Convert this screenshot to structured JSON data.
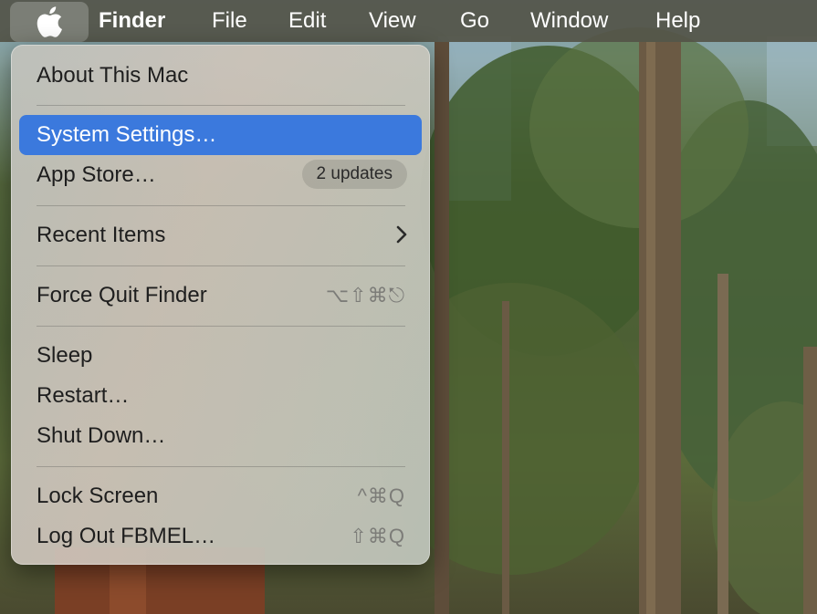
{
  "menubar": {
    "app_name": "Finder",
    "items": [
      "File",
      "Edit",
      "View",
      "Go",
      "Window",
      "Help"
    ]
  },
  "apple_menu": {
    "about": "About This Mac",
    "system_settings": "System Settings…",
    "app_store": "App Store…",
    "app_store_badge": "2 updates",
    "recent_items": "Recent Items",
    "force_quit": "Force Quit Finder",
    "force_quit_shortcut": "⌥⇧⌘⎋",
    "sleep": "Sleep",
    "restart": "Restart…",
    "shut_down": "Shut Down…",
    "lock_screen": "Lock Screen",
    "lock_screen_shortcut": "^⌘Q",
    "log_out": "Log Out FBMEL…",
    "log_out_shortcut": "⇧⌘Q"
  },
  "colors": {
    "highlight": "#3b79dd",
    "menubar": "#545448"
  },
  "icons": {
    "apple": "apple-logo-icon",
    "submenu": "chevron-right-icon"
  }
}
